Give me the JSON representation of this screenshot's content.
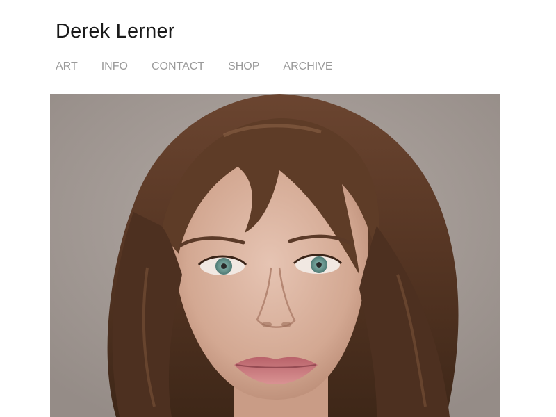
{
  "site": {
    "title": "Derek Lerner"
  },
  "nav": {
    "items": [
      {
        "label": "ART"
      },
      {
        "label": "INFO"
      },
      {
        "label": "CONTACT"
      },
      {
        "label": "SHOP"
      },
      {
        "label": "ARCHIVE"
      }
    ]
  },
  "main": {
    "image": {
      "alt": "",
      "background_color": "#a8a09b",
      "hair_color": "#5b3a24",
      "skin_color": "#d9b3a0",
      "eye_color": "#6f9c95",
      "lip_color": "#c97a7a"
    }
  }
}
